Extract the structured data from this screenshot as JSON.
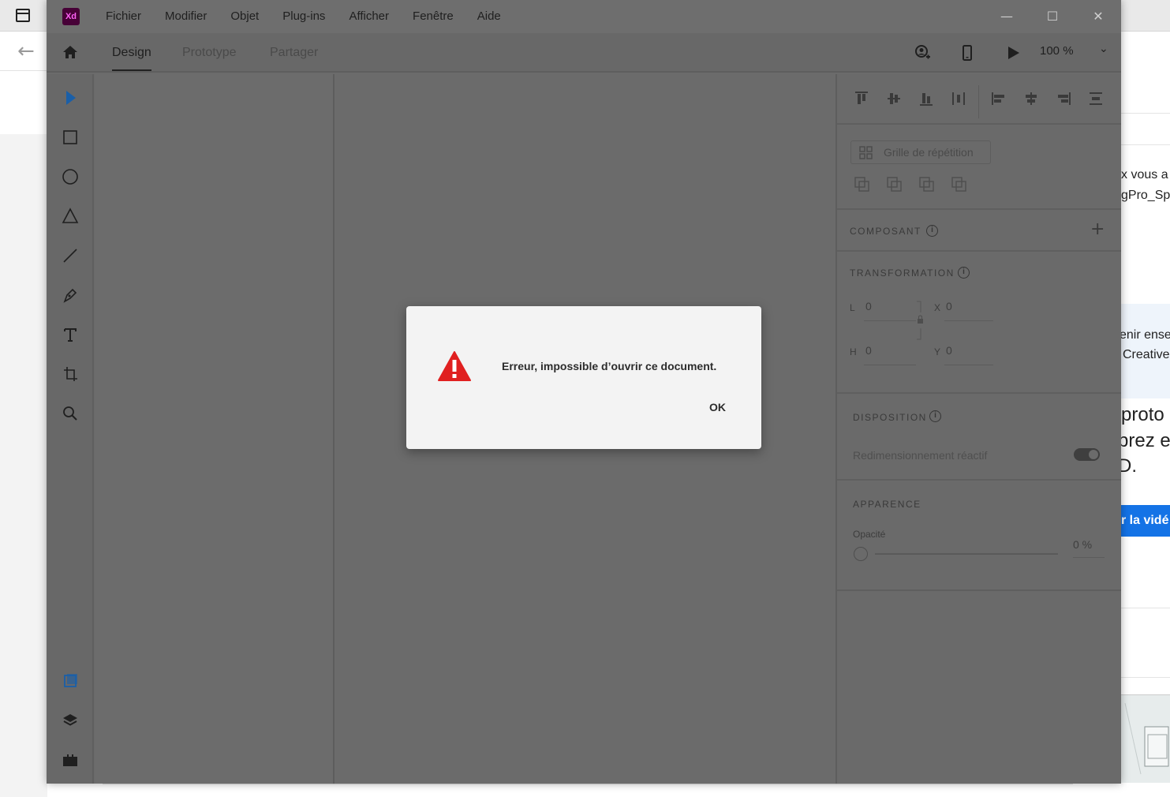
{
  "background": {
    "right_fragments": [
      "x  vous a",
      "gPro_Sp",
      "enir ense",
      "Creative",
      "proto",
      "prez et",
      "D.",
      "r la vidé"
    ],
    "accent_color": "#1473e6"
  },
  "app": {
    "logo_text": "Xd",
    "menu": [
      "Fichier",
      "Modifier",
      "Objet",
      "Plug-ins",
      "Afficher",
      "Fenêtre",
      "Aide"
    ],
    "window_controls": {
      "minimize": "—",
      "maximize": "☐",
      "close": "✕"
    },
    "tabs": {
      "design": "Design",
      "prototype": "Prototype",
      "share": "Partager"
    },
    "zoom": "100 %",
    "zoom_chevron": "⌄"
  },
  "properties": {
    "repeat_grid": "Grille de répétition",
    "component": {
      "label": "COMPOSANT",
      "add": "+"
    },
    "transformation": {
      "label": "TRANSFORMATION",
      "w_label": "L",
      "w_value": "0",
      "x_label": "X",
      "x_value": "0",
      "h_label": "H",
      "h_value": "0",
      "y_label": "Y",
      "y_value": "0"
    },
    "layout": {
      "label": "DISPOSITION",
      "responsive_resize": "Redimensionnement réactif",
      "responsive_on": true
    },
    "appearance": {
      "label": "APPARENCE",
      "opacity_label": "Opacité",
      "opacity_value": "0 %",
      "opacity_fraction": 0
    }
  },
  "dialog": {
    "message": "Erreur, impossible d’ouvrir ce document.",
    "ok": "OK",
    "icon": "warning-icon",
    "icon_color": "#e02020"
  }
}
